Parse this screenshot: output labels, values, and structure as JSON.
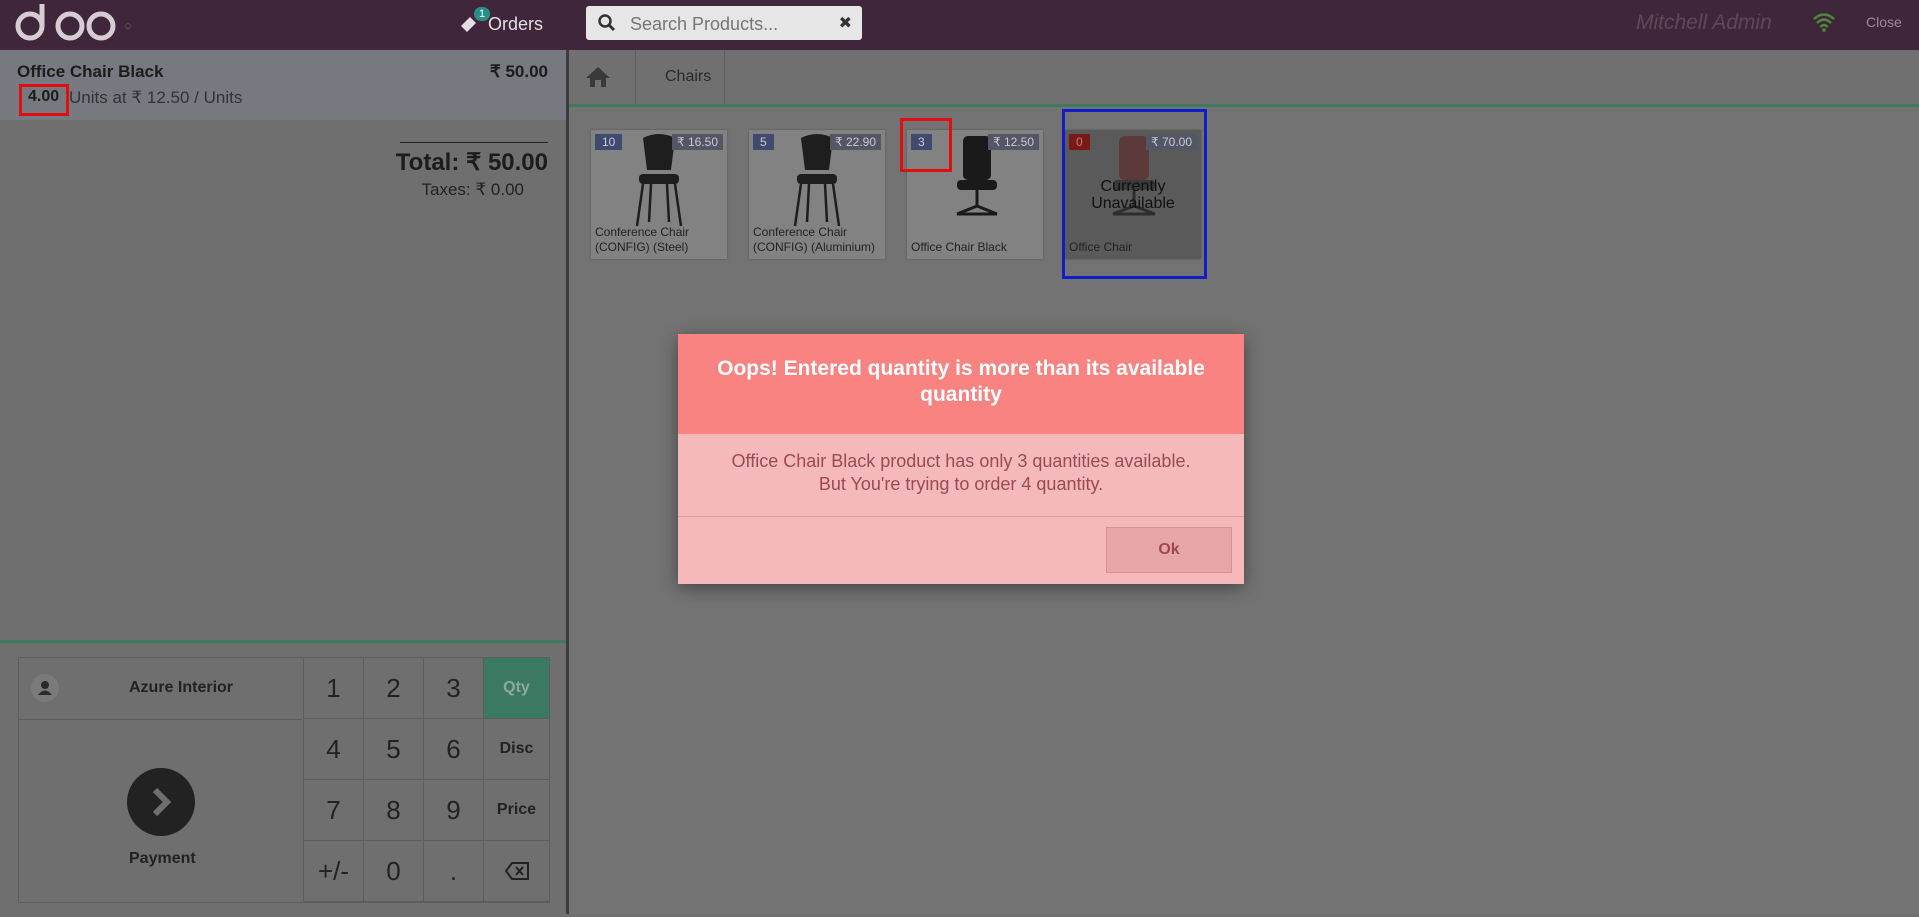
{
  "header": {
    "logo_text": "odoo",
    "orders_label": "Orders",
    "orders_badge": "1",
    "search_placeholder": "Search Products...",
    "user_name": "Mitchell Admin",
    "close_label": "Close"
  },
  "order": {
    "line": {
      "name": "Office Chair Black",
      "price": "₹ 50.00",
      "qty": "4.00",
      "unit_text": "Units at ₹ 12.50 / Units"
    },
    "total": "Total: ₹ 50.00",
    "taxes": "Taxes: ₹ 0.00"
  },
  "numpad": {
    "customer": "Azure Interior",
    "payment": "Payment",
    "keys": [
      "1",
      "2",
      "3",
      "4",
      "5",
      "6",
      "7",
      "8",
      "9",
      "+/-",
      "0",
      "."
    ],
    "modes": [
      "Qty",
      "Disc",
      "Price"
    ],
    "selected_mode": "Qty"
  },
  "breadcrumb": {
    "category": "Chairs"
  },
  "products": [
    {
      "name_l1": "Conference Chair",
      "name_l2": "(CONFIG) (Steel)",
      "price": "₹ 16.50",
      "stock": "10"
    },
    {
      "name_l1": "Conference Chair",
      "name_l2": "(CONFIG) (Aluminium)",
      "price": "₹ 22.90",
      "stock": "5"
    },
    {
      "name_l1": "Office Chair Black",
      "name_l2": "",
      "price": "₹ 12.50",
      "stock": "3"
    },
    {
      "name_l1": "Office Chair",
      "name_l2": "",
      "price": "₹ 70.00",
      "stock": "0",
      "overlay_l1": "Currently",
      "overlay_l2": "Unavailable"
    }
  ],
  "dialog": {
    "title": "Oops! Entered quantity is more than its available quantity",
    "message_l1": "Office Chair Black product has only 3 quantities available.",
    "message_l2": "But You're trying to order 4 quantity.",
    "ok_label": "Ok"
  },
  "colors": {
    "topbar": "#40263a",
    "dialog_header": "#f88380",
    "dialog_body": "#f5b8bb",
    "selected_mode": "#3b7a61",
    "highlight_red": "#e01010",
    "highlight_blue": "#0f1fc7"
  }
}
